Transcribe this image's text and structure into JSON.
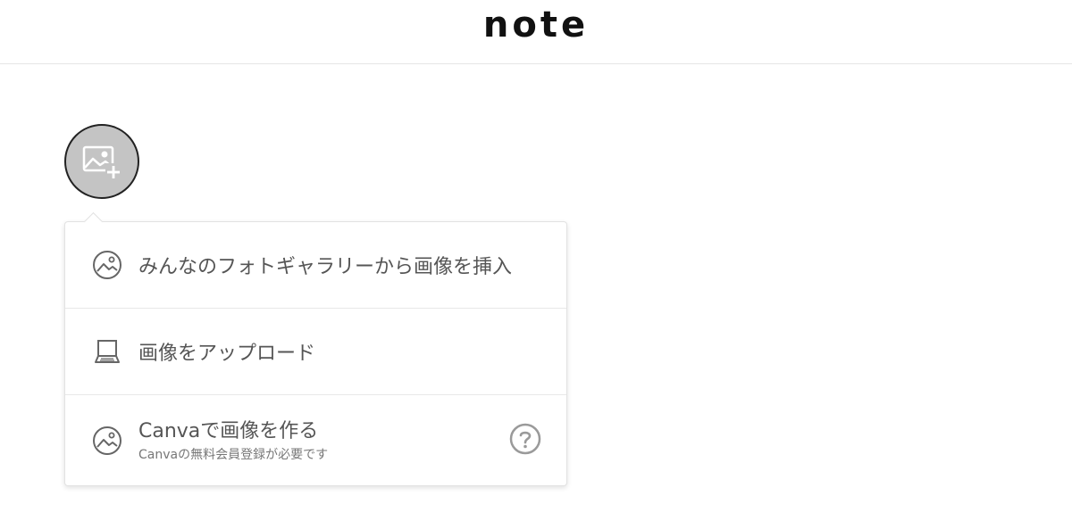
{
  "header": {
    "logo_text": "note"
  },
  "add_image_button": {
    "icon": "image-plus-icon"
  },
  "popover": {
    "items": [
      {
        "label": "みんなのフォトギャラリーから画像を挿入",
        "icon": "image-icon"
      },
      {
        "label": "画像をアップロード",
        "icon": "laptop-icon"
      },
      {
        "label": "Canvaで画像を作る",
        "sub_label": "Canvaの無料会員登録が必要です",
        "icon": "image-icon",
        "help_icon": "question-circle-icon"
      }
    ]
  },
  "colors": {
    "icon_gray": "#666666",
    "button_fill": "#c4c4c4",
    "help_gray": "#9a9a9a"
  }
}
